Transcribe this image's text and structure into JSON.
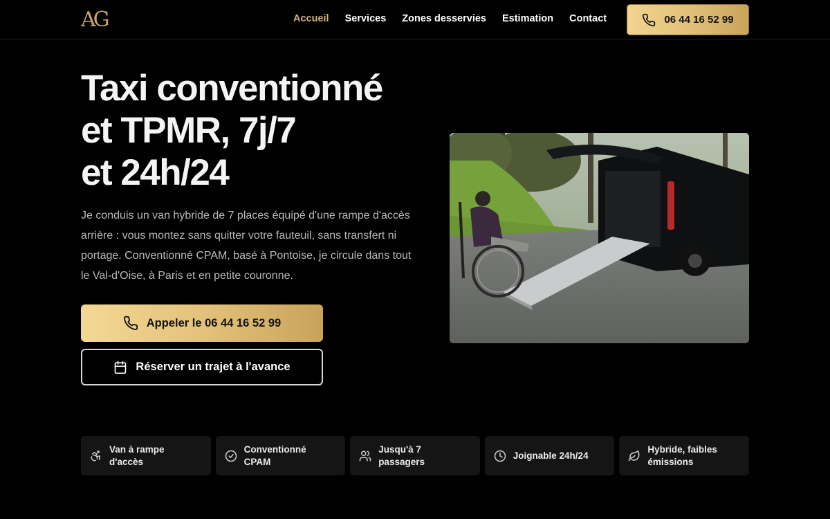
{
  "header": {
    "logo_text": "AG",
    "nav": [
      {
        "label": "Accueil",
        "active": true
      },
      {
        "label": "Services",
        "active": false
      },
      {
        "label": "Zones desservies",
        "active": false
      },
      {
        "label": "Estimation",
        "active": false
      },
      {
        "label": "Contact",
        "active": false
      }
    ],
    "phone": "06 44 16 52 99"
  },
  "hero": {
    "title_lines": [
      "Taxi conventionné",
      "et TPMR, 7j/7",
      "et 24h/24"
    ],
    "description": "Je conduis un van hybride de 7 places équipé d'une rampe d'accès arrière : vous montez sans quitter votre fauteuil, sans transfert ni portage. Conventionné CPAM, basé à Pontoise, je circule dans tout le Val-d'Oise, à Paris et en petite couronne.",
    "call_button": "Appeler le 06 44 16 52 99",
    "book_button": "Réserver un trajet à l'avance"
  },
  "features": [
    {
      "icon": "wheelchair-icon",
      "label": "Van à rampe d'accès"
    },
    {
      "icon": "check-circle-icon",
      "label": "Conventionné CPAM"
    },
    {
      "icon": "users-icon",
      "label": "Jusqu'à 7 passagers"
    },
    {
      "icon": "clock-icon",
      "label": "Joignable 24h/24"
    },
    {
      "icon": "leaf-icon",
      "label": "Hybride, faibles émissions"
    }
  ],
  "colors": {
    "background": "#000000",
    "gold_accent": "#d4b174",
    "card_background": "#151515"
  }
}
